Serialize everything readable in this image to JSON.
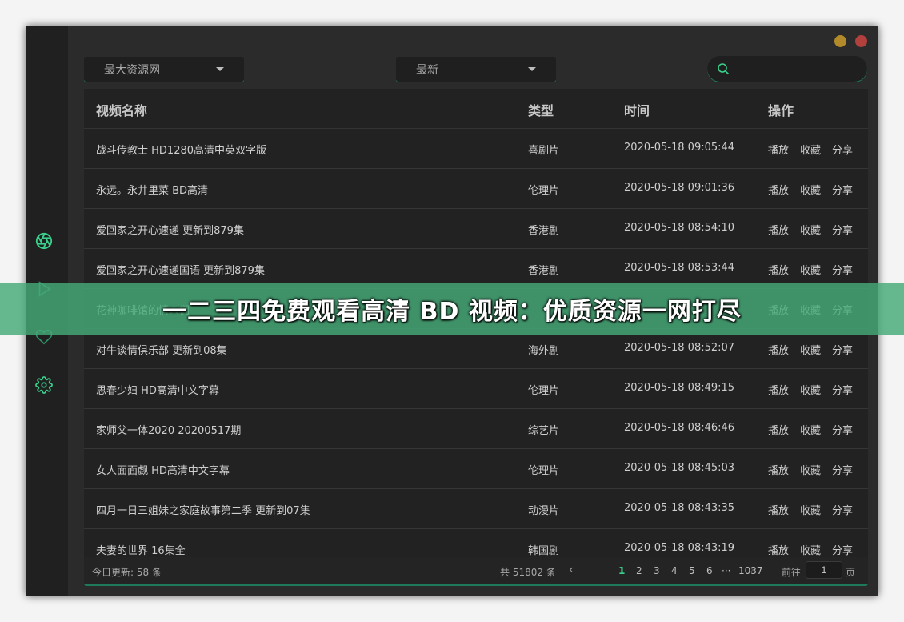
{
  "colors": {
    "accent": "#39d18c",
    "close": "#b2403c",
    "minimize": "#b38a2a",
    "overlay": "#46aa78"
  },
  "toolbar": {
    "source_select": "最大资源网",
    "sort_select": "最新",
    "search_placeholder": ""
  },
  "sidebar": {
    "icons": [
      "aperture-icon",
      "play-icon",
      "heart-icon",
      "settings-icon"
    ]
  },
  "table": {
    "headers": {
      "name": "视频名称",
      "type": "类型",
      "time": "时间",
      "actions": "操作"
    },
    "actions": {
      "play": "播放",
      "collect": "收藏",
      "share": "分享"
    },
    "rows": [
      {
        "name": "战斗传教士 HD1280高清中英双字版",
        "type": "喜剧片",
        "time": "2020-05-18 09:05:44"
      },
      {
        "name": "永远。永井里菜 BD高清",
        "type": "伦理片",
        "time": "2020-05-18 09:01:36"
      },
      {
        "name": "爱回家之开心速递 更新到879集",
        "type": "香港剧",
        "time": "2020-05-18 08:54:10"
      },
      {
        "name": "爱回家之开心速递国语 更新到879集",
        "type": "香港剧",
        "time": "2020-05-18 08:53:44"
      },
      {
        "name": "花神咖啡馆的情人们",
        "type": "",
        "time": ""
      },
      {
        "name": "对牛谈情俱乐部 更新到08集",
        "type": "海外剧",
        "time": "2020-05-18 08:52:07"
      },
      {
        "name": "思春少妇 HD高清中文字幕",
        "type": "伦理片",
        "time": "2020-05-18 08:49:15"
      },
      {
        "name": "家师父一体2020 20200517期",
        "type": "综艺片",
        "time": "2020-05-18 08:46:46"
      },
      {
        "name": "女人面面觑 HD高清中文字幕",
        "type": "伦理片",
        "time": "2020-05-18 08:45:03"
      },
      {
        "name": "四月一日三姐妹之家庭故事第二季 更新到07集",
        "type": "动漫片",
        "time": "2020-05-18 08:43:35"
      },
      {
        "name": "夫妻的世界 16集全",
        "type": "韩国剧",
        "time": "2020-05-18 08:43:19"
      }
    ]
  },
  "footer": {
    "today_updates": "今日更新: 58 条",
    "total": "共 51802 条",
    "pages": [
      "1",
      "2",
      "3",
      "4",
      "5",
      "6",
      "···",
      "1037"
    ],
    "goto_prefix": "前往",
    "goto_value": "1",
    "goto_suffix": "页"
  },
  "banner": {
    "title": "一二三四免费观看高清 BD 视频：优质资源一网打尽"
  }
}
